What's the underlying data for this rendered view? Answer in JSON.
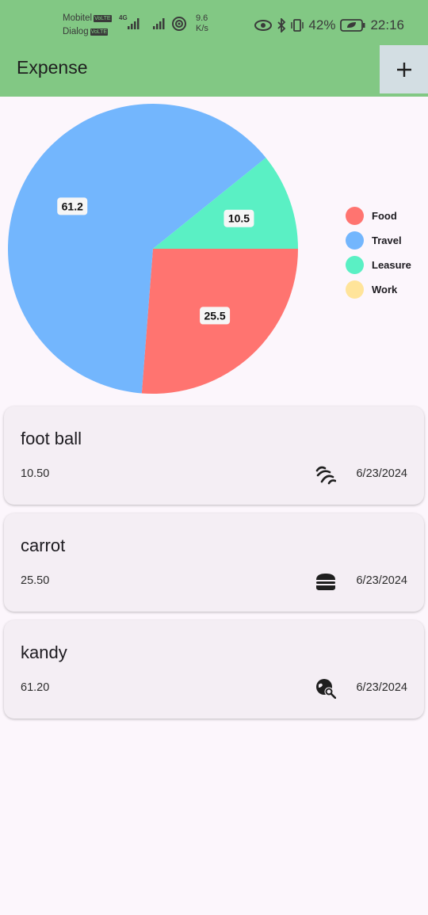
{
  "status_bar": {
    "carrier1": "Mobitel",
    "carrier2": "Dialog",
    "volte": "VoLTE",
    "network": "4G",
    "speed_value": "9.6",
    "speed_unit": "K/s",
    "battery": "42%",
    "time": "22:16"
  },
  "app_bar": {
    "title": "Expense",
    "add_label": "+"
  },
  "chart_data": {
    "type": "pie",
    "categories": [
      "Food",
      "Travel",
      "Leasure",
      "Work"
    ],
    "values": [
      25.5,
      61.2,
      10.5,
      0
    ],
    "data_labels": [
      "25.5",
      "61.2",
      "10.5",
      ""
    ],
    "colors": [
      "#ff7470",
      "#73b6fd",
      "#5af0c4",
      "#ffe49a"
    ],
    "legend_position": "right"
  },
  "expenses": [
    {
      "title": "foot ball",
      "amount": "10.50",
      "date": "6/23/2024",
      "icon": "leisure-icon"
    },
    {
      "title": "carrot",
      "amount": "25.50",
      "date": "6/23/2024",
      "icon": "food-icon"
    },
    {
      "title": "kandy",
      "amount": "61.20",
      "date": "6/23/2024",
      "icon": "travel-icon"
    }
  ]
}
